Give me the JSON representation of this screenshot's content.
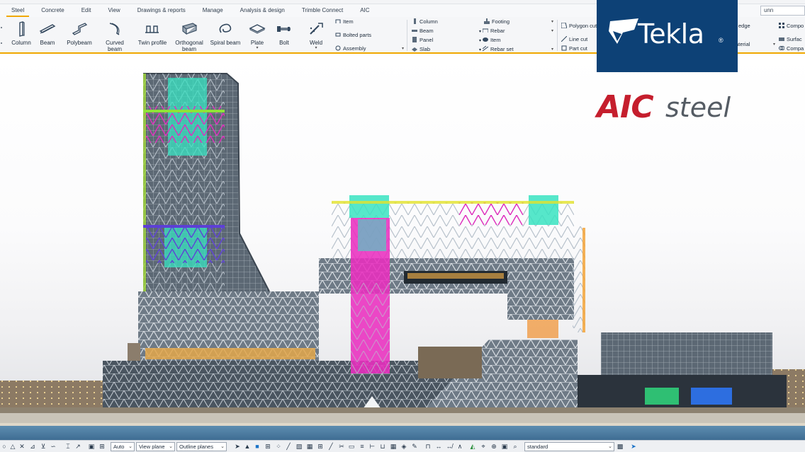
{
  "ribbon_tabs": [
    "Steel",
    "Concrete",
    "Edit",
    "View",
    "Drawings & reports",
    "Manage",
    "Analysis & design",
    "Trimble Connect",
    "AIC"
  ],
  "active_tab": "Steel",
  "search": {
    "value": "unn"
  },
  "steel_tools": [
    {
      "label": "Column",
      "icon": "column-icon"
    },
    {
      "label": "Beam",
      "icon": "beam-icon"
    },
    {
      "label": "Polybeam",
      "icon": "polybeam-icon"
    },
    {
      "label": "Curved beam",
      "icon": "curved-beam-icon"
    },
    {
      "label": "Twin profile",
      "icon": "twin-profile-icon"
    },
    {
      "label": "Orthogonal beam",
      "icon": "orthogonal-beam-icon"
    },
    {
      "label": "Spiral beam",
      "icon": "spiral-beam-icon"
    },
    {
      "label": "Plate",
      "icon": "plate-icon"
    },
    {
      "label": "Bolt",
      "icon": "bolt-icon"
    },
    {
      "label": "Weld",
      "icon": "weld-icon"
    }
  ],
  "steel_small": [
    "Item",
    "Bolted parts",
    "Assembly"
  ],
  "concrete_small_a": [
    "Column",
    "Beam",
    "Panel",
    "Slab"
  ],
  "concrete_small_b": [
    "Footing",
    "Rebar",
    "Item",
    "Rebar set"
  ],
  "edit_small": [
    "Polygon cut",
    "Line cut",
    "Part cut"
  ],
  "right_partial": [
    "edge",
    "aterial"
  ],
  "far_right_small": [
    "Compo",
    "Surfac",
    "Compa"
  ],
  "logos": {
    "brand": "Tekla",
    "reg_mark": "®",
    "partner_a": "AIC",
    "partner_b": "steel"
  },
  "bottom_bar": {
    "select_auto": "Auto",
    "select_view_plane": "View plane",
    "select_outline": "Outline planes",
    "select_standard": "standard"
  },
  "colors": {
    "accent": "#f0a800",
    "tekla_blue": "#0d4176",
    "aic_red": "#c51e2d",
    "steel_gray": "#555c64"
  }
}
